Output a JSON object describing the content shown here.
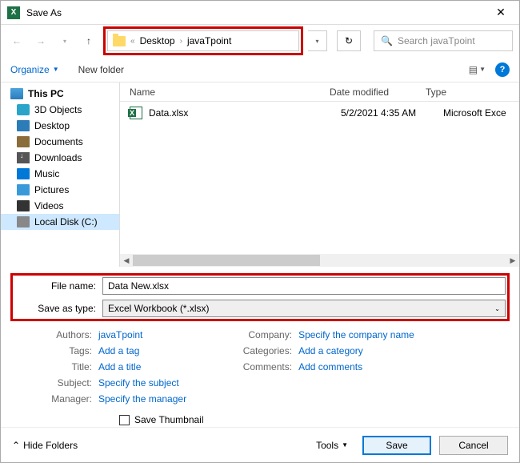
{
  "title": "Save As",
  "breadcrumb": {
    "sep": "«",
    "items": [
      "Desktop",
      "javaTpoint"
    ]
  },
  "search": {
    "placeholder": "Search javaTpoint"
  },
  "toolbar": {
    "organize": "Organize",
    "newfolder": "New folder"
  },
  "sidebar": {
    "items": [
      {
        "label": "This PC",
        "icon": "pc",
        "top": true
      },
      {
        "label": "3D Objects",
        "icon": "3d"
      },
      {
        "label": "Desktop",
        "icon": "desktop"
      },
      {
        "label": "Documents",
        "icon": "doc"
      },
      {
        "label": "Downloads",
        "icon": "dl"
      },
      {
        "label": "Music",
        "icon": "music"
      },
      {
        "label": "Pictures",
        "icon": "pic"
      },
      {
        "label": "Videos",
        "icon": "vid"
      },
      {
        "label": "Local Disk (C:)",
        "icon": "disk",
        "sel": true
      }
    ]
  },
  "columns": {
    "name": "Name",
    "date": "Date modified",
    "type": "Type"
  },
  "files": [
    {
      "name": "Data.xlsx",
      "date": "5/2/2021 4:35 AM",
      "type": "Microsoft Exce"
    }
  ],
  "filename_label": "File name:",
  "filename_value": "Data New.xlsx",
  "savetype_label": "Save as type:",
  "savetype_value": "Excel Workbook (*.xlsx)",
  "meta": {
    "left": [
      {
        "label": "Authors:",
        "value": "javaTpoint"
      },
      {
        "label": "Tags:",
        "value": "Add a tag"
      },
      {
        "label": "Title:",
        "value": "Add a title"
      },
      {
        "label": "Subject:",
        "value": "Specify the subject"
      },
      {
        "label": "Manager:",
        "value": "Specify the manager"
      }
    ],
    "right": [
      {
        "label": "Company:",
        "value": "Specify the company name"
      },
      {
        "label": "Categories:",
        "value": "Add a category"
      },
      {
        "label": "Comments:",
        "value": "Add comments"
      }
    ]
  },
  "save_thumbnail": "Save Thumbnail",
  "footer": {
    "hide": "Hide Folders",
    "tools": "Tools",
    "save": "Save",
    "cancel": "Cancel"
  }
}
